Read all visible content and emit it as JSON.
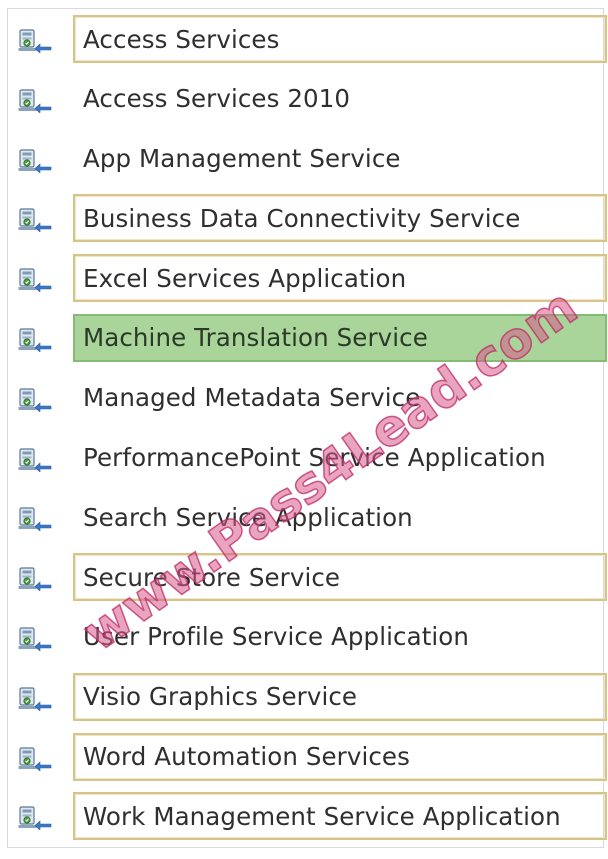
{
  "colors": {
    "selected_background": "#a9d49a",
    "selected_border": "#86bb73",
    "box_border": "#d6c48a",
    "watermark": "#d75a8c"
  },
  "icon": "service-application-icon",
  "services": [
    {
      "label": "Access Services",
      "boxed": true,
      "selected": false
    },
    {
      "label": "Access Services 2010",
      "boxed": false,
      "selected": false
    },
    {
      "label": "App Management Service",
      "boxed": false,
      "selected": false
    },
    {
      "label": "Business Data Connectivity Service",
      "boxed": true,
      "selected": false
    },
    {
      "label": "Excel Services Application",
      "boxed": true,
      "selected": false
    },
    {
      "label": "Machine Translation Service",
      "boxed": false,
      "selected": true
    },
    {
      "label": "Managed Metadata Service",
      "boxed": false,
      "selected": false
    },
    {
      "label": "PerformancePoint Service Application",
      "boxed": false,
      "selected": false
    },
    {
      "label": "Search Service Application",
      "boxed": false,
      "selected": false
    },
    {
      "label": "Secure Store Service",
      "boxed": true,
      "selected": false
    },
    {
      "label": "User Profile Service Application",
      "boxed": false,
      "selected": false
    },
    {
      "label": "Visio Graphics Service",
      "boxed": true,
      "selected": false
    },
    {
      "label": "Word Automation Services",
      "boxed": true,
      "selected": false
    },
    {
      "label": "Work Management Service Application",
      "boxed": true,
      "selected": false
    }
  ],
  "watermark": "www.Pass4Lead.com"
}
